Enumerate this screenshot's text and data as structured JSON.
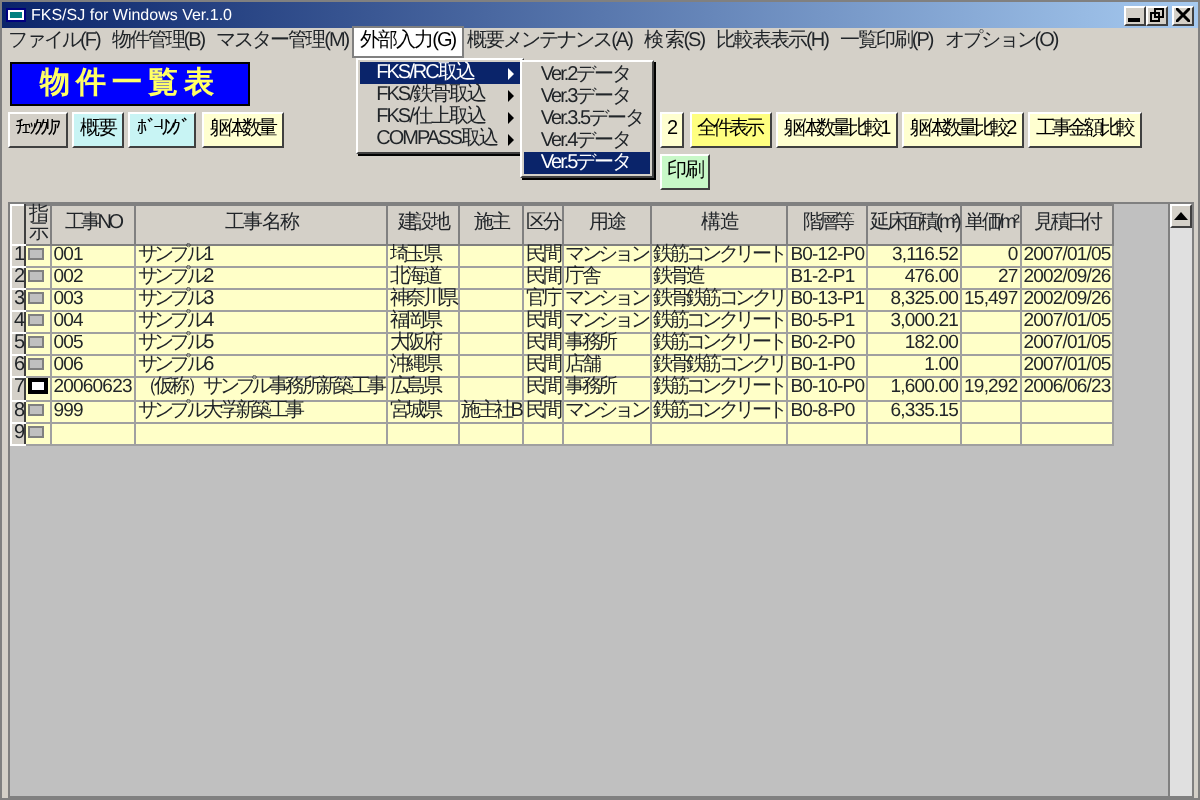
{
  "window": {
    "title": "FKS/SJ for Windows Ver.1.0"
  },
  "menu_bar": [
    {
      "label": "ファイル(F)",
      "selected": false
    },
    {
      "label": "物件管理(B)",
      "selected": false
    },
    {
      "label": "マスター管理(M)",
      "selected": false
    },
    {
      "label": "外部入力(G)",
      "selected": true
    },
    {
      "label": "概要メンテナンス(A)",
      "selected": false
    },
    {
      "label": "検 索(S)",
      "selected": false
    },
    {
      "label": "比較表表示(H)",
      "selected": false
    },
    {
      "label": "一覧印刷(P)",
      "selected": false
    },
    {
      "label": "オプション(O)",
      "selected": false
    }
  ],
  "open_menu": {
    "items": [
      {
        "label": "FKS/RC取込",
        "selected": true,
        "has_submenu": true
      },
      {
        "label": "FKS/鉄骨取込",
        "selected": false,
        "has_submenu": true
      },
      {
        "label": "FKS/仕上取込",
        "selected": false,
        "has_submenu": true
      },
      {
        "label": "COMPASS取込",
        "selected": false,
        "has_submenu": true
      }
    ],
    "submenu": [
      {
        "label": "Ver.2データ",
        "selected": false
      },
      {
        "label": "Ver.3データ",
        "selected": false
      },
      {
        "label": "Ver.3.5データ",
        "selected": false
      },
      {
        "label": "Ver.4データ",
        "selected": false
      },
      {
        "label": "Ver.5データ",
        "selected": true
      }
    ]
  },
  "banner": {
    "title": "物件一覧表"
  },
  "toolbar_left": [
    {
      "label": "ﾁｪｯｸｸﾘｱ",
      "color": "#d4d0c8"
    },
    {
      "label": "概 要",
      "color": "#c8f4f4"
    },
    {
      "label": "ﾎﾞｰﾘﾝｸﾞ",
      "color": "#c8f4f4"
    },
    {
      "label": "躯体数量",
      "color": "#ffffd0"
    }
  ],
  "toolbar_right": [
    {
      "label": "2",
      "color": "#ffffd0"
    },
    {
      "label": "全件表示",
      "color": "#ffff80"
    },
    {
      "label": "躯体数量比較1",
      "color": "#ffffd0"
    },
    {
      "label": "躯体数量比較2",
      "color": "#ffffd0"
    },
    {
      "label": "工事金額比較",
      "color": "#ffffd0"
    },
    {
      "label": "印 刷",
      "color": "#c8f8c8"
    }
  ],
  "table": {
    "columns": [
      "",
      "指示",
      "工事NO",
      "工 事 名 称",
      "建設地",
      "施主",
      "区分",
      "用 途",
      "構 造",
      "階層等",
      "延床面積(m²)",
      "単価/m²",
      "見積日付"
    ],
    "rows": [
      {
        "selected": false,
        "cells": [
          "1",
          "",
          "001",
          "サンプル1",
          "埼玉県",
          "",
          "民間",
          "マンション",
          "鉄筋コンクリート",
          "B0-12-P0",
          "3,116.52",
          "0",
          "2007/01/05"
        ]
      },
      {
        "selected": false,
        "cells": [
          "2",
          "",
          "002",
          "サンプル2",
          "北海道",
          "",
          "民間",
          "庁舎",
          "鉄骨造",
          "B1-2-P1",
          "476.00",
          "27",
          "2002/09/26"
        ]
      },
      {
        "selected": false,
        "cells": [
          "3",
          "",
          "003",
          "サンプル3",
          "神奈川県",
          "",
          "官庁",
          "マンション",
          "鉄骨鉄筋コンクリ",
          "B0-13-P1",
          "8,325.00",
          "15,497",
          "2002/09/26"
        ]
      },
      {
        "selected": false,
        "cells": [
          "4",
          "",
          "004",
          "サンプル4",
          "福岡県",
          "",
          "民間",
          "マンション",
          "鉄筋コンクリート",
          "B0-5-P1",
          "3,000.21",
          "",
          "2007/01/05"
        ]
      },
      {
        "selected": false,
        "cells": [
          "5",
          "",
          "005",
          "サンプル5",
          "大阪府",
          "",
          "民間",
          "事務所",
          "鉄筋コンクリート",
          "B0-2-P0",
          "182.00",
          "",
          "2007/01/05"
        ]
      },
      {
        "selected": false,
        "cells": [
          "6",
          "",
          "006",
          "サンプル6",
          "沖縄県",
          "",
          "民間",
          "店舗",
          "鉄骨鉄筋コンクリ",
          "B0-1-P0",
          "1.00",
          "",
          "2007/01/05"
        ]
      },
      {
        "selected": true,
        "cells": [
          "7",
          "",
          "20060623",
          "（仮称）サンプル事務所新築工事",
          "広島県",
          "",
          "民間",
          "事務所",
          "鉄筋コンクリート",
          "B0-10-P0",
          "1,600.00",
          "19,292",
          "2006/06/23"
        ]
      },
      {
        "selected": false,
        "cells": [
          "8",
          "",
          "999",
          "サンプル大学新築工事",
          "宮城県",
          "施主社B",
          "民間",
          "マンション",
          "鉄筋コンクリート",
          "B0-8-P0",
          "6,335.15",
          "",
          ""
        ]
      },
      {
        "selected": false,
        "cells": [
          "9",
          "",
          "",
          "",
          "",
          "",
          "",
          "",
          "",
          "",
          "",
          "",
          ""
        ]
      }
    ]
  }
}
